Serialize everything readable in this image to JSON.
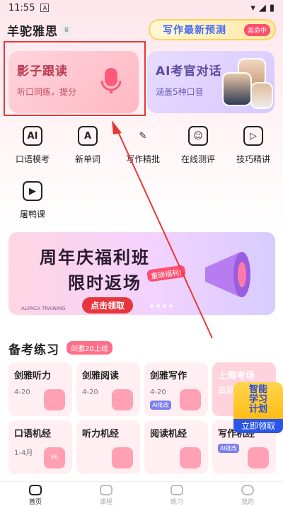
{
  "status_bar": {
    "time": "11:55",
    "sim": "A"
  },
  "header": {
    "brand": "羊驼雅思",
    "promo_text": "写作最新预测",
    "promo_badge": "高命中"
  },
  "cards": {
    "shadow_reading": {
      "title": "影子跟读",
      "subtitle": "听口同练，提分"
    },
    "ai_examiner": {
      "title": "AI考官对话",
      "subtitle": "涵盖5种口音"
    }
  },
  "tools": [
    {
      "label": "口语模考",
      "icon": "ai-chat-icon",
      "glyph": "AI"
    },
    {
      "label": "新单词",
      "icon": "book-a-icon",
      "glyph": "A"
    },
    {
      "label": "写作精批",
      "icon": "pen-icon",
      "glyph": "✎"
    },
    {
      "label": "在线测评",
      "icon": "robot-icon",
      "glyph": "☺"
    },
    {
      "label": "技巧精讲",
      "icon": "play-icon",
      "glyph": "▷"
    },
    {
      "label": "屠鸭课",
      "icon": "video-icon",
      "glyph": "▶"
    }
  ],
  "banner": {
    "line1": "周年庆福利班",
    "line2": "限时返场",
    "tag": "重磅福利!",
    "cta": "点击领取",
    "brand": "ALPACA TRAINING"
  },
  "section": {
    "title": "备考练习",
    "badge": "剑雅20上线"
  },
  "tiles": [
    {
      "title": "剑雅听力",
      "date": "4-20"
    },
    {
      "title": "剑雅阅读",
      "date": "4-20"
    },
    {
      "title": "剑雅写作",
      "date": "4-20",
      "ai": "AI批改"
    },
    {
      "title": "上周考场",
      "date": "真题"
    },
    {
      "title": "口语机经",
      "date": "1-4月",
      "hi": "Hi"
    },
    {
      "title": "听力机经",
      "date": ""
    },
    {
      "title": "阅读机经",
      "date": ""
    },
    {
      "title": "写作机经",
      "date": "",
      "ai": "AI批改"
    }
  ],
  "float_promo": {
    "line1": "智能",
    "line2": "学习",
    "line3": "计划",
    "cta": "立即领取"
  },
  "tabbar": [
    {
      "label": "首页",
      "active": true
    },
    {
      "label": "课程",
      "active": false
    },
    {
      "label": "练习",
      "active": false
    },
    {
      "label": "我的",
      "active": false
    }
  ],
  "colors": {
    "accent_red": "#e53935",
    "brand_pink": "#ff6e88",
    "cta_blue": "#2a55e8"
  }
}
